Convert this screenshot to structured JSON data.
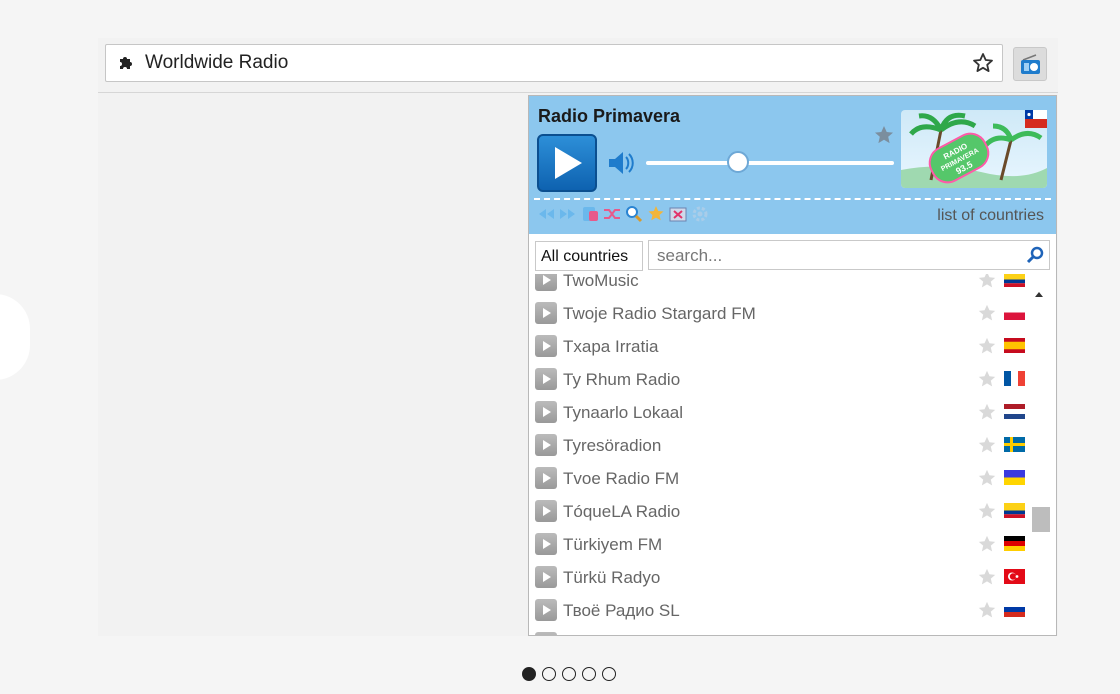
{
  "omnibox": {
    "text": "Worldwide Radio"
  },
  "player": {
    "station_title": "Radio Primavera",
    "volume_level": 0.37,
    "logo_text": [
      "RADIO",
      "PRIMAVERA",
      "93.5"
    ],
    "list_of_countries_label": "list of countries"
  },
  "filter": {
    "country_select": "All countries",
    "search_placeholder": "search..."
  },
  "stations": [
    {
      "name": "TwoMusic",
      "flag": "colombia"
    },
    {
      "name": "Twoje Radio Stargard FM",
      "flag": "poland"
    },
    {
      "name": "Txapa Irratia",
      "flag": "spain"
    },
    {
      "name": "Ty Rhum Radio",
      "flag": "france"
    },
    {
      "name": "Tynaarlo Lokaal",
      "flag": "netherlands"
    },
    {
      "name": "Tyresöradion",
      "flag": "sweden"
    },
    {
      "name": "Tvoe Radio FM",
      "flag": "ukraine"
    },
    {
      "name": "TóqueLA Radio",
      "flag": "colombia"
    },
    {
      "name": "Türkiyem FM",
      "flag": "germany"
    },
    {
      "name": "Türkü Radyo",
      "flag": "turkey"
    },
    {
      "name": "Твоё Радио SL",
      "flag": "russia"
    }
  ],
  "carousel": {
    "total": 5,
    "active": 1
  },
  "colors": {
    "player_bg": "#8cc7ee",
    "play_button": "#1a74c4",
    "accent_link": "#2a7fd0"
  }
}
